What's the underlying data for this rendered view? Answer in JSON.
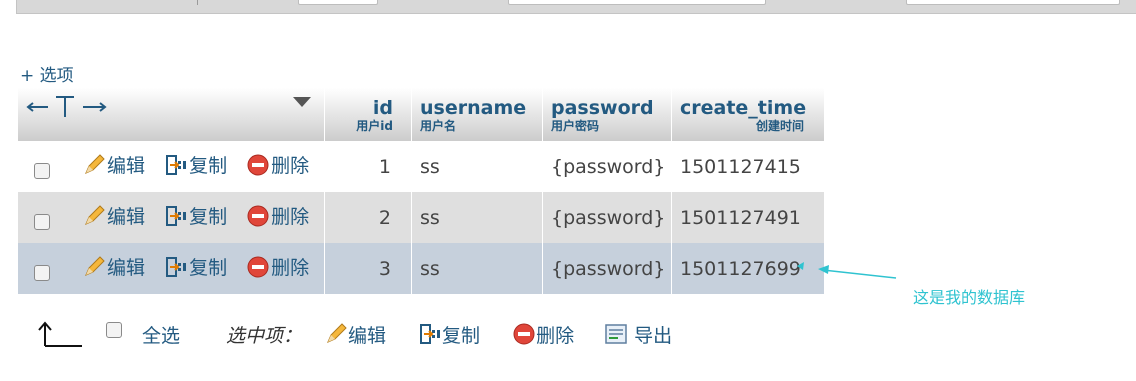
{
  "options_toggle": "+ 选项",
  "header": {
    "id": {
      "name": "id",
      "comment": "用户id"
    },
    "username": {
      "name": "username",
      "comment": "用户名"
    },
    "password": {
      "name": "password",
      "comment": "用户密码"
    },
    "create_time": {
      "name": "create_time",
      "comment": "创建时间"
    }
  },
  "actions": {
    "edit": "编辑",
    "copy": "复制",
    "delete": "删除"
  },
  "rows": [
    {
      "id": "1",
      "username": "ss",
      "password": "{password}",
      "create_time": "1501127415"
    },
    {
      "id": "2",
      "username": "ss",
      "password": "{password}",
      "create_time": "1501127491"
    },
    {
      "id": "3",
      "username": "ss",
      "password": "{password}",
      "create_time": "1501127699"
    }
  ],
  "footer": {
    "select_all": "全选",
    "with_selected": "选中项：",
    "edit": "编辑",
    "copy": "复制",
    "delete": "删除",
    "export": "导出"
  },
  "annotation": {
    "text": "这是我的数据库",
    "color": "#2fc3d0"
  },
  "colors": {
    "link": "#235a81",
    "row_marked": "#c6d0dc",
    "row_even": "#dfdfdf"
  }
}
